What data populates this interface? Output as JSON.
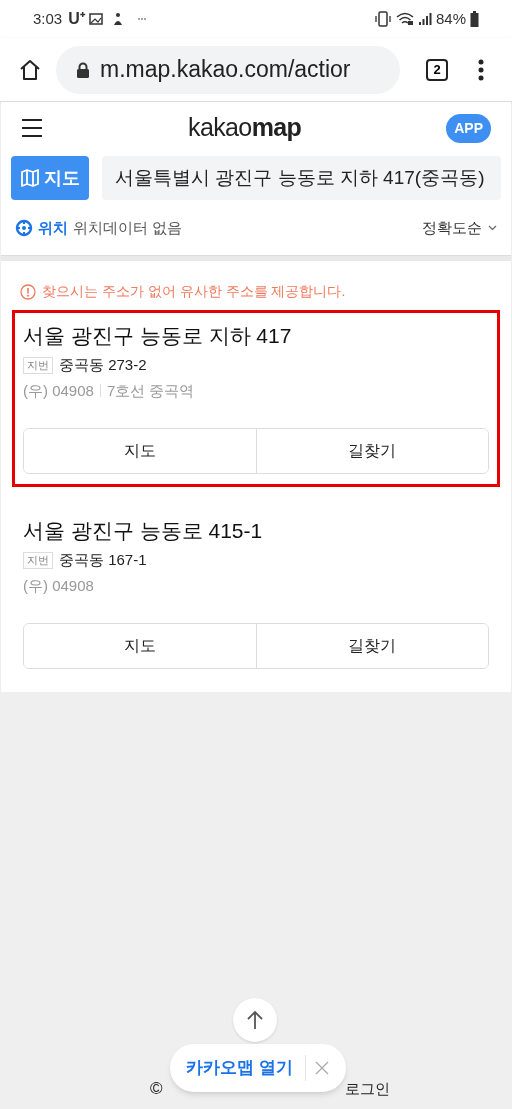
{
  "status_bar": {
    "time": "3:03",
    "carrier": "U⁺",
    "battery": "84%"
  },
  "browser": {
    "url": "m.map.kakao.com/actior",
    "tab_count": "2"
  },
  "header": {
    "logo_light": "kakao",
    "logo_bold": "map",
    "app_badge": "APP"
  },
  "search": {
    "map_button": "지도",
    "query": "서울특별시 광진구 능동로 지하 417(중곡동)"
  },
  "location": {
    "label": "위치",
    "value": "위치데이터 없음",
    "sort": "정확도순"
  },
  "notice": "찾으시는 주소가 없어 유사한 주소를 제공합니다.",
  "results": [
    {
      "title": "서울 광진구 능동로 지하 417",
      "lot_tag": "지번",
      "lot": "중곡동 273-2",
      "postal": "(우) 04908",
      "subway": "7호선 중곡역",
      "highlighted": true,
      "buttons": [
        "지도",
        "길찾기"
      ]
    },
    {
      "title": "서울 광진구 능동로 415-1",
      "lot_tag": "지번",
      "lot": "중곡동 167-1",
      "postal": "(우) 04908",
      "highlighted": false,
      "buttons": [
        "지도",
        "길찾기"
      ]
    }
  ],
  "open_app": {
    "label": "카카오맵 열기"
  },
  "footer": {
    "copyright": "©",
    "login": "로그인"
  }
}
